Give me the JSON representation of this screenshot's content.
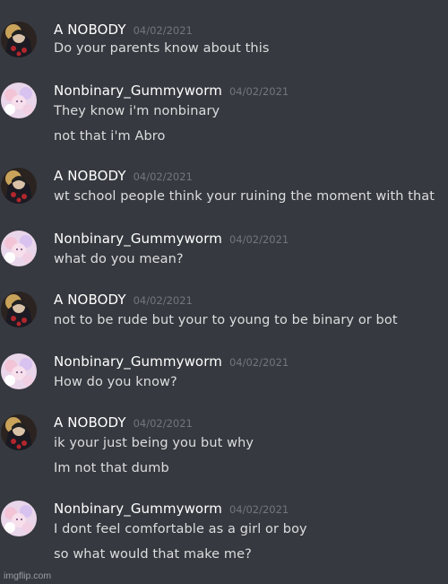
{
  "messages": [
    {
      "user": "A NOBODY",
      "avatar": "dark-cloak-avatar",
      "timestamp": "04/02/2021",
      "lines": [
        "Do your parents know about this"
      ]
    },
    {
      "user": "Nonbinary_Gummyworm",
      "avatar": "pastel-group-avatar",
      "timestamp": "04/02/2021",
      "lines": [
        "They know i'm nonbinary",
        "not that i'm Abro"
      ]
    },
    {
      "user": "A NOBODY",
      "avatar": "dark-cloak-avatar",
      "timestamp": "04/02/2021",
      "lines": [
        "wt school people think your ruining the moment with that"
      ]
    },
    {
      "user": "Nonbinary_Gummyworm",
      "avatar": "pastel-group-avatar",
      "timestamp": "04/02/2021",
      "lines": [
        "what do you mean?"
      ]
    },
    {
      "user": "A NOBODY",
      "avatar": "dark-cloak-avatar",
      "timestamp": "04/02/2021",
      "lines": [
        "not to be rude but your to young to be binary or bot"
      ]
    },
    {
      "user": "Nonbinary_Gummyworm",
      "avatar": "pastel-group-avatar",
      "timestamp": "04/02/2021",
      "lines": [
        "How do you know?"
      ]
    },
    {
      "user": "A NOBODY",
      "avatar": "dark-cloak-avatar",
      "timestamp": "04/02/2021",
      "lines": [
        "ik your just being you but why",
        "Im not that dumb"
      ]
    },
    {
      "user": "Nonbinary_Gummyworm",
      "avatar": "pastel-group-avatar",
      "timestamp": "04/02/2021",
      "lines": [
        "I dont feel comfortable as a girl or boy",
        "so what would that make me?"
      ]
    }
  ],
  "watermark": "imgflip.com",
  "colors": {
    "background": "#36393f",
    "username": "#ffffff",
    "timestamp": "#72767d",
    "message_text": "#dcddde"
  }
}
